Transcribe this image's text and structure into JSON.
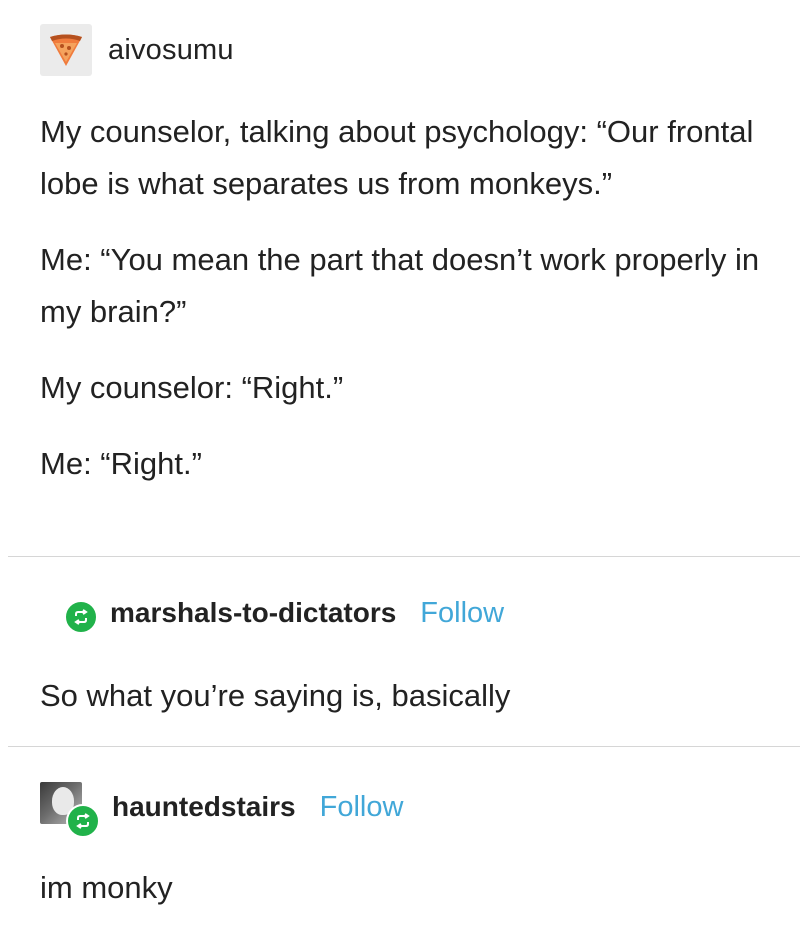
{
  "original_post": {
    "username": "aivosumu",
    "avatar_icon": "pizza-slice-icon",
    "paragraphs": [
      "My counselor, talking about psychology: “Our frontal lobe is what separates us from monkeys.”",
      "Me: “You mean the part that doesn’t work properly in my brain?”",
      "My counselor: “Right.”",
      "Me: “Right.”"
    ]
  },
  "reblogs": [
    {
      "username": "marshals-to-dictators",
      "follow_label": "Follow",
      "badge_icon": "reblog-icon",
      "text": "So what you’re saying is, basically"
    },
    {
      "username": "hauntedstairs",
      "follow_label": "Follow",
      "badge_icon": "reblog-icon",
      "text": "im monky"
    }
  ],
  "colors": {
    "follow": "#41a7d8",
    "reblog_badge": "#21b24a",
    "divider": "#d6d6d6"
  }
}
